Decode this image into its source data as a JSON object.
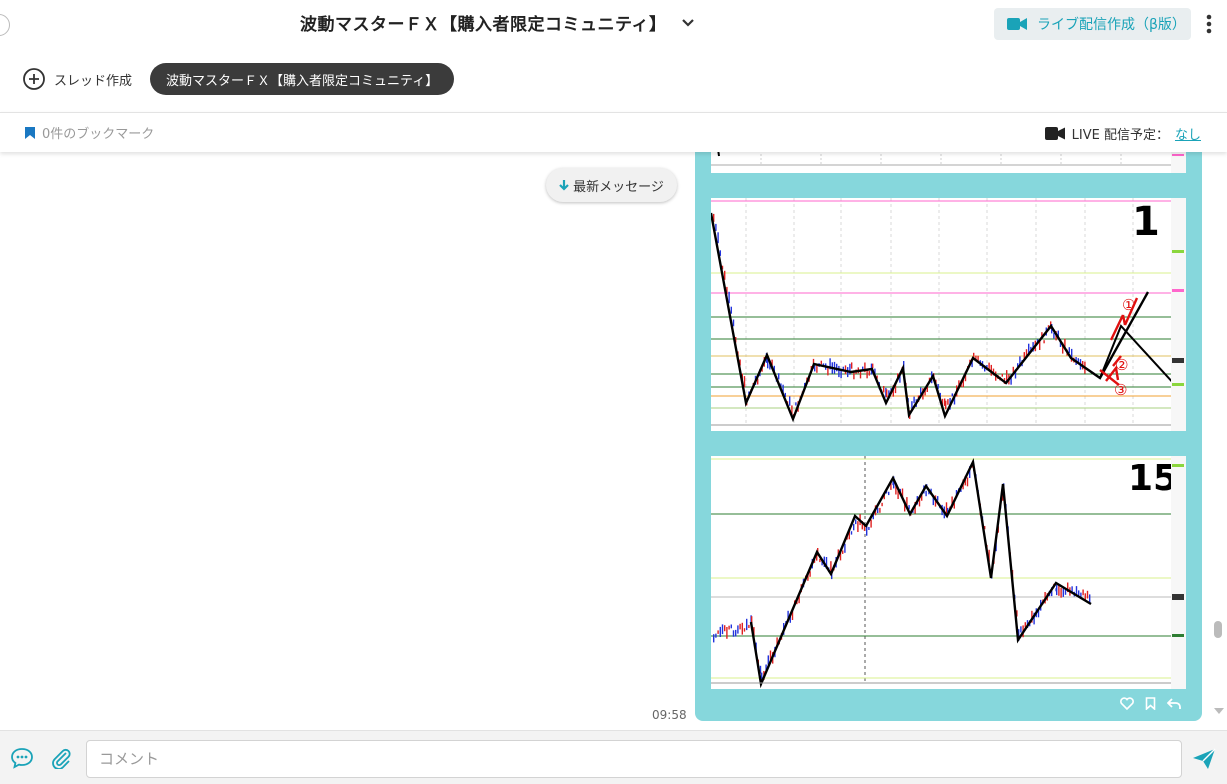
{
  "header": {
    "title": "波動マスターＦＸ【購入者限定コミュニティ】",
    "live_button": "ライブ配信作成（β版）"
  },
  "thread_bar": {
    "new_thread": "スレッド作成",
    "active_thread": "波動マスターＦＸ【購入者限定コミュニティ】"
  },
  "bookmark_bar": {
    "bookmarks": "0件のブックマーク",
    "live_label": "LIVE 配信予定：",
    "live_value": "なし"
  },
  "chat": {
    "latest_button": "最新メッセージ",
    "message_time": "09:58",
    "chart_labels": [
      "1",
      "15"
    ],
    "annotations": [
      "①",
      "②",
      "③"
    ]
  },
  "composer": {
    "placeholder": "コメント"
  },
  "colors": {
    "accent": "#1aa3b8",
    "bubble": "#86d7dc",
    "chip": "#3b3b3b"
  }
}
